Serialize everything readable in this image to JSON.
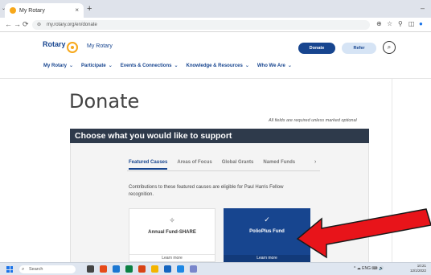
{
  "browser": {
    "tab_title": "My Rotary",
    "tab_close": "×",
    "new_tab": "+",
    "tab_dropdown": "⌄",
    "window_min": "–",
    "back": "←",
    "forward": "→",
    "reload": "⟳",
    "url": "my.rotary.org/en/donate",
    "right_icons": [
      "⊕",
      "☆",
      "⚲",
      "◫",
      "●"
    ]
  },
  "header": {
    "brand": "Rotary",
    "my_rotary": "My Rotary",
    "donate_label": "Donate",
    "refer_label": "Refer",
    "search_glyph": "⌕"
  },
  "nav": {
    "items": [
      {
        "label": "My Rotary",
        "chevron": "⌄"
      },
      {
        "label": "Participate",
        "chevron": "⌄"
      },
      {
        "label": "Events & Connections",
        "chevron": "⌄"
      },
      {
        "label": "Knowledge & Resources",
        "chevron": "⌄"
      },
      {
        "label": "Who We Are",
        "chevron": "⌄"
      }
    ]
  },
  "page": {
    "title": "Donate",
    "required_note": "All fields are required unless marked optional",
    "panel_title": "Choose what you would like to support",
    "tabs": [
      {
        "label": "Featured Causes",
        "active": true
      },
      {
        "label": "Areas of Focus",
        "active": false
      },
      {
        "label": "Global Grants",
        "active": false
      },
      {
        "label": "Named Funds",
        "active": false
      }
    ],
    "tab_next": "›",
    "description": "Contributions to these featured causes are eligible for Paul Harris Fellow recognition.",
    "cards": [
      {
        "title": "Annual Fund-SHARE",
        "icon": "✧",
        "link": "Learn more"
      },
      {
        "title": "PolioPlus Fund",
        "icon": "✓",
        "link": "Learn more"
      }
    ]
  },
  "taskbar": {
    "search_placeholder": "Search",
    "search_icon": "⌕",
    "tray_text": "^ ☁ ENG ⌨ 🔊",
    "time": "10:21",
    "date": "12/1/2022"
  },
  "colors": {
    "rotary_blue": "#17458f",
    "rotary_gold": "#f7a81b",
    "panel_header": "#2e3a4b",
    "arrow_red": "#e8141a"
  }
}
